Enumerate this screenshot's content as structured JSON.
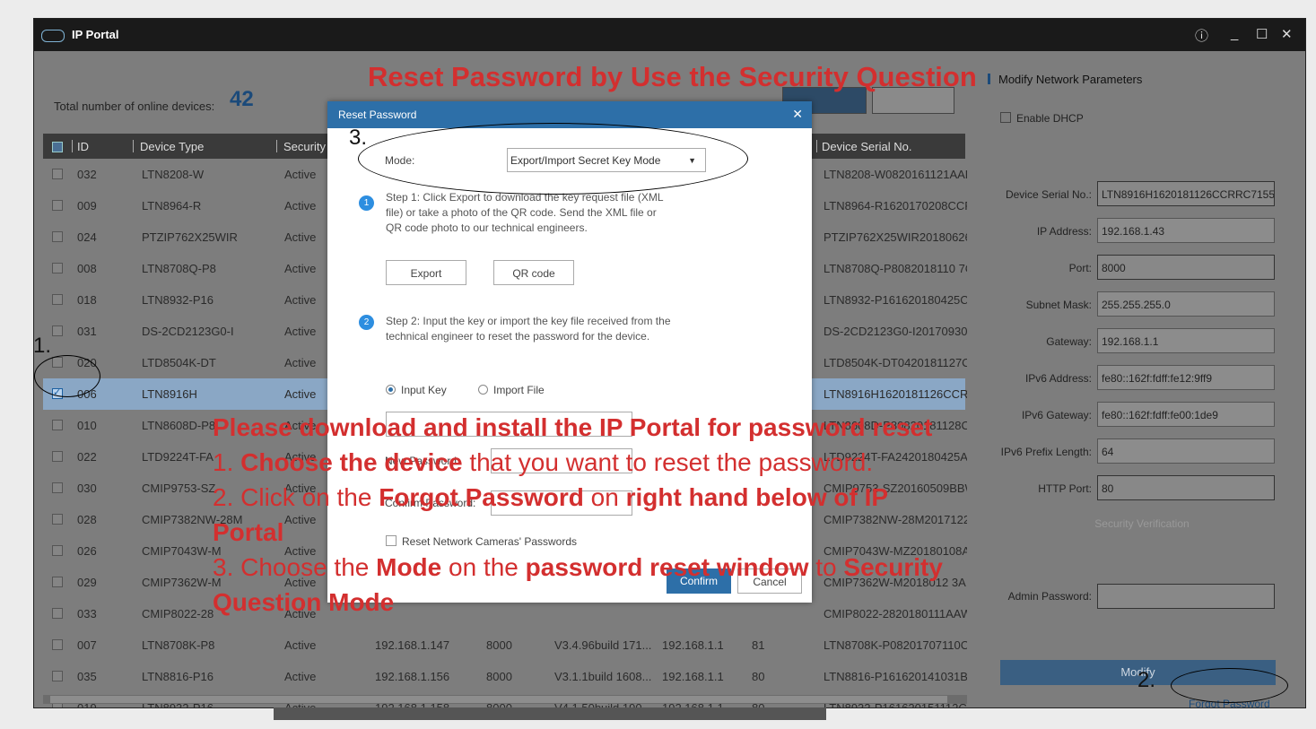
{
  "window": {
    "title": "IP Portal"
  },
  "header": {
    "total_label": "Total number of online devices:",
    "total_count": "42"
  },
  "table": {
    "columns": [
      "ID",
      "Device Type",
      "Security",
      "Device Serial No."
    ],
    "rows": [
      {
        "id": "032",
        "type": "LTN8208-W",
        "security": "Active",
        "serial": "LTN8208-W0820161121AAF",
        "checked": false
      },
      {
        "id": "009",
        "type": "LTN8964-R",
        "security": "Active",
        "serial": "LTN8964-R1620170208CCR",
        "checked": false
      },
      {
        "id": "024",
        "type": "PTZIP762X25WIR",
        "security": "Active",
        "serial": "PTZIP762X25WIR20180626",
        "checked": false
      },
      {
        "id": "008",
        "type": "LTN8708Q-P8",
        "security": "Active",
        "serial": "LTN8708Q-P8082018110 7C",
        "checked": false
      },
      {
        "id": "018",
        "type": "LTN8932-P16",
        "security": "Active",
        "serial": "LTN8932-P161620180425CC",
        "checked": false
      },
      {
        "id": "031",
        "type": "DS-2CD2123G0-I",
        "security": "Active",
        "serial": "DS-2CD2123G0-I20170930A",
        "checked": false
      },
      {
        "id": "020",
        "type": "LTD8504K-DT",
        "security": "Active",
        "serial": "LTD8504K-DT0420181127C",
        "checked": false
      },
      {
        "id": "006",
        "type": "LTN8916H",
        "security": "Active",
        "serial": "LTN8916H1620181126CCRF",
        "checked": true
      },
      {
        "id": "010",
        "type": "LTN8608D-P8",
        "security": "Active",
        "serial": "LTN8608D-P80820181128C",
        "checked": false
      },
      {
        "id": "022",
        "type": "LTD9224T-FA",
        "security": "Active",
        "serial": "LTD9224T-FA2420180425AA",
        "checked": false
      },
      {
        "id": "030",
        "type": "CMIP9753-SZ",
        "security": "Active",
        "serial": "CMIP9753-SZ20160509BBW",
        "checked": false
      },
      {
        "id": "028",
        "type": "CMIP7382NW-28M",
        "security": "Active",
        "serial": "CMIP7382NW-28M2017122",
        "checked": false
      },
      {
        "id": "026",
        "type": "CMIP7043W-M",
        "security": "Active",
        "serial": "CMIP7043W-MZ20180108A",
        "checked": false
      },
      {
        "id": "029",
        "type": "CMIP7362W-M",
        "security": "Active",
        "serial": "CMIP7362W-M2018012 3A",
        "checked": false
      },
      {
        "id": "033",
        "type": "CMIP8022-28",
        "security": "Active",
        "serial": "CMIP8022-2820180111AAW",
        "checked": false
      },
      {
        "id": "007",
        "type": "LTN8708K-P8",
        "security": "Active",
        "ip": "192.168.1.147",
        "port": "8000",
        "version": "V3.4.96build 171...",
        "gateway": "192.168.1.1",
        "http": "81",
        "serial": "LTN8708K-P08201707110C",
        "checked": false
      },
      {
        "id": "035",
        "type": "LTN8816-P16",
        "security": "Active",
        "ip": "192.168.1.156",
        "port": "8000",
        "version": "V3.1.1build 1608...",
        "gateway": "192.168.1.1",
        "http": "80",
        "serial": "LTN8816-P161620141031BE",
        "checked": false
      },
      {
        "id": "019",
        "type": "LTN8932-P16",
        "security": "Active",
        "ip": "192.168.1.158",
        "port": "8000",
        "version": "V4.1.50build 190...",
        "gateway": "192.168.1.1",
        "http": "80",
        "serial": "LTN8932-P161620151112CC",
        "checked": false
      }
    ]
  },
  "right_panel": {
    "title": "Modify Network Parameters",
    "dhcp_label": "Enable DHCP",
    "fields": [
      {
        "label": "Device Serial No.:",
        "value": "LTN8916H1620181126CCRRC7155"
      },
      {
        "label": "IP Address:",
        "value": "192.168.1.43"
      },
      {
        "label": "Port:",
        "value": "8000"
      },
      {
        "label": "Subnet Mask:",
        "value": "255.255.255.0"
      },
      {
        "label": "Gateway:",
        "value": "192.168.1.1"
      },
      {
        "label": "IPv6 Address:",
        "value": "fe80::162f:fdff:fe12:9ff9"
      },
      {
        "label": "IPv6 Gateway:",
        "value": "fe80::162f:fdff:fe00:1de9"
      },
      {
        "label": "IPv6 Prefix Length:",
        "value": "64"
      },
      {
        "label": "HTTP Port:",
        "value": "80"
      }
    ],
    "security_verification": "Security Verification",
    "admin_password_label": "Admin Password:",
    "modify_label": "Modify",
    "forgot_label": "Forgot Password"
  },
  "dialog": {
    "title": "Reset Password",
    "mode_label": "Mode:",
    "mode_value": "Export/Import Secret Key Mode",
    "step1_num": "1",
    "step1_text": "Step 1: Click Export to download the key request file (XML file) or take a photo of the QR code. Send the XML file or QR code photo to our technical engineers.",
    "export_label": "Export",
    "qr_label": "QR code",
    "step2_num": "2",
    "step2_text": "Step 2: Input the key or import the key file received from the technical engineer to reset the password for the device.",
    "input_key_label": "Input Key",
    "import_file_label": "Import File",
    "new_password_label": "New Password:",
    "confirm_password_label": "Confirm Password:",
    "reset_cameras_label": "Reset Network Cameras' Passwords",
    "confirm_label": "Confirm",
    "cancel_label": "Cancel"
  },
  "annotations": {
    "headline": "Reset Password by Use the Security Question",
    "line0": "Please download and install the IP Portal for password reset",
    "line1_a": "1. ",
    "line1_b": "Choose the device",
    "line1_c": " that you want to reset the password.",
    "line2_a": "2. Click on the ",
    "line2_b": "Forgot Password",
    "line2_c": " on ",
    "line2_d": "right hand below of IP",
    "line3": "Portal",
    "line4_a": "3. Choose the ",
    "line4_b": "Mode",
    "line4_c": " on the ",
    "line4_d": "password reset window",
    "line4_e": " to ",
    "line4_f": "Security",
    "line5": "Question Mode",
    "marker1": "1.",
    "marker2": "2.",
    "marker3": "3."
  },
  "colors": {
    "annotation_red": "#d32f2f",
    "dialog_blue": "#2d6fa8",
    "titlebar": "#1a1a1a"
  }
}
